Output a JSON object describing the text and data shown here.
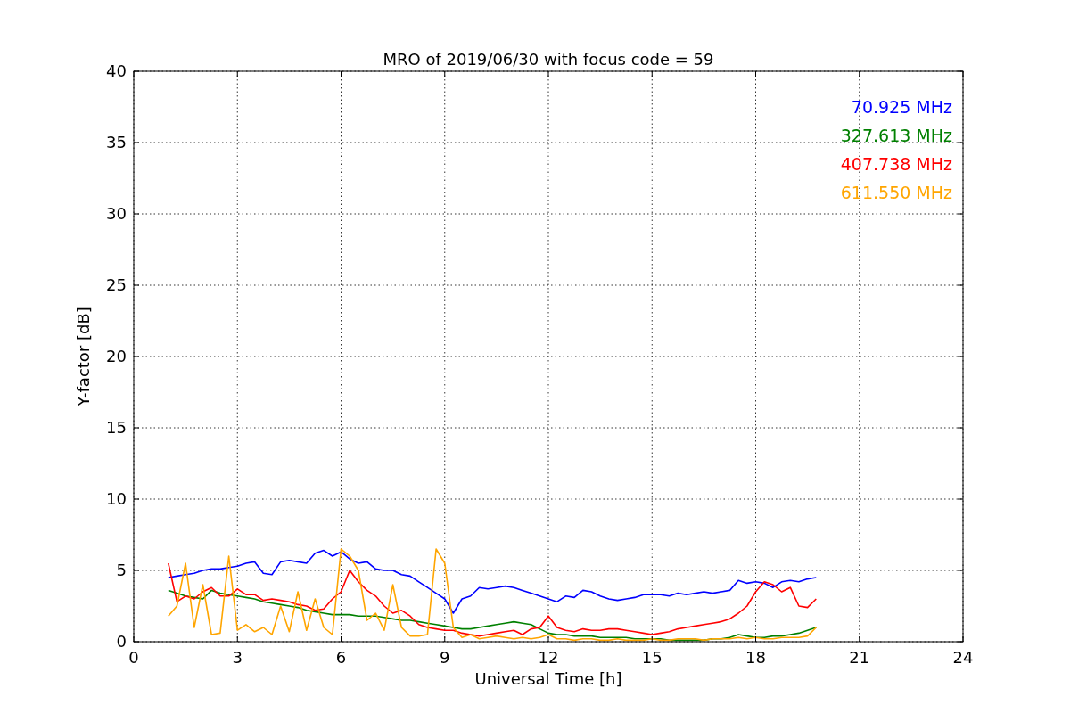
{
  "chart_data": {
    "type": "line",
    "title": "MRO of 2019/06/30 with focus code = 59",
    "xlabel": "Universal Time [h]",
    "ylabel": "Y-factor [dB]",
    "x": [
      1,
      1.25,
      1.5,
      1.75,
      2,
      2.25,
      2.5,
      2.75,
      3,
      3.25,
      3.5,
      3.75,
      4,
      4.25,
      4.5,
      4.75,
      5,
      5.25,
      5.5,
      5.75,
      6,
      6.25,
      6.5,
      6.75,
      7,
      7.25,
      7.5,
      7.75,
      8,
      8.25,
      8.5,
      8.75,
      9,
      9.25,
      9.5,
      9.75,
      10,
      10.25,
      10.5,
      10.75,
      11,
      11.25,
      11.5,
      11.75,
      12,
      12.25,
      12.5,
      12.75,
      13,
      13.25,
      13.5,
      13.75,
      14,
      14.25,
      14.5,
      14.75,
      15,
      15.25,
      15.5,
      15.75,
      16,
      16.25,
      16.5,
      16.75,
      17,
      17.25,
      17.5,
      17.75,
      18,
      18.25,
      18.5,
      18.75,
      19,
      19.25,
      19.5,
      19.75
    ],
    "series": [
      {
        "name": "70.925 MHz",
        "color": "#0000ff",
        "values": [
          4.5,
          4.6,
          4.7,
          4.8,
          5.0,
          5.1,
          5.1,
          5.2,
          5.3,
          5.5,
          5.6,
          4.8,
          4.7,
          5.6,
          5.7,
          5.6,
          5.5,
          6.2,
          6.4,
          6.0,
          6.3,
          5.8,
          5.5,
          5.6,
          5.1,
          5.0,
          5.0,
          4.7,
          4.6,
          4.2,
          3.8,
          3.4,
          3.0,
          2.0,
          3.0,
          3.2,
          3.8,
          3.7,
          3.8,
          3.9,
          3.8,
          3.6,
          3.4,
          3.2,
          3.0,
          2.8,
          3.2,
          3.1,
          3.6,
          3.5,
          3.2,
          3.0,
          2.9,
          3.0,
          3.1,
          3.3,
          3.3,
          3.3,
          3.2,
          3.4,
          3.3,
          3.4,
          3.5,
          3.4,
          3.5,
          3.6,
          4.3,
          4.1,
          4.2,
          4.1,
          3.8,
          4.2,
          4.3,
          4.2,
          4.4,
          4.5
        ]
      },
      {
        "name": "327.613 MHz",
        "color": "#008000",
        "values": [
          3.6,
          3.4,
          3.2,
          3.1,
          3.0,
          3.6,
          3.4,
          3.3,
          3.2,
          3.1,
          3.0,
          2.8,
          2.7,
          2.6,
          2.5,
          2.4,
          2.2,
          2.1,
          2.0,
          1.9,
          1.9,
          1.9,
          1.8,
          1.8,
          1.8,
          1.7,
          1.6,
          1.5,
          1.5,
          1.4,
          1.3,
          1.2,
          1.1,
          1.0,
          0.9,
          0.9,
          1.0,
          1.1,
          1.2,
          1.3,
          1.4,
          1.3,
          1.2,
          0.9,
          0.6,
          0.5,
          0.5,
          0.4,
          0.4,
          0.4,
          0.3,
          0.3,
          0.3,
          0.3,
          0.2,
          0.2,
          0.2,
          0.2,
          0.1,
          0.1,
          0.1,
          0.1,
          0.1,
          0.2,
          0.2,
          0.3,
          0.5,
          0.4,
          0.3,
          0.3,
          0.4,
          0.4,
          0.5,
          0.6,
          0.8,
          1.0
        ]
      },
      {
        "name": "407.738 MHz",
        "color": "#ff0000",
        "values": [
          5.5,
          2.8,
          3.2,
          3.0,
          3.5,
          3.8,
          3.2,
          3.2,
          3.7,
          3.3,
          3.3,
          2.9,
          3.0,
          2.9,
          2.8,
          2.6,
          2.5,
          2.2,
          2.3,
          3.0,
          3.5,
          5.0,
          4.2,
          3.6,
          3.2,
          2.5,
          2.0,
          2.2,
          1.8,
          1.2,
          1.0,
          0.9,
          0.8,
          0.8,
          0.6,
          0.5,
          0.4,
          0.5,
          0.6,
          0.7,
          0.8,
          0.5,
          0.9,
          1.0,
          1.8,
          1.0,
          0.8,
          0.7,
          0.9,
          0.8,
          0.8,
          0.9,
          0.9,
          0.8,
          0.7,
          0.6,
          0.5,
          0.6,
          0.7,
          0.9,
          1.0,
          1.1,
          1.2,
          1.3,
          1.4,
          1.6,
          2.0,
          2.5,
          3.5,
          4.2,
          4.0,
          3.5,
          3.8,
          2.5,
          2.4,
          3.0
        ]
      },
      {
        "name": "611.550 MHz",
        "color": "#ffa500",
        "values": [
          1.8,
          2.5,
          5.5,
          1.0,
          4.0,
          0.5,
          0.6,
          6.0,
          0.8,
          1.2,
          0.7,
          1.0,
          0.5,
          2.5,
          0.7,
          3.5,
          0.8,
          3.0,
          1.0,
          0.5,
          6.5,
          6.0,
          5.0,
          1.5,
          2.0,
          0.8,
          4.0,
          1.0,
          0.4,
          0.4,
          0.5,
          6.5,
          5.5,
          1.0,
          0.3,
          0.5,
          0.2,
          0.3,
          0.4,
          0.3,
          0.2,
          0.3,
          0.2,
          0.3,
          0.5,
          0.2,
          0.2,
          0.1,
          0.2,
          0.2,
          0.1,
          0.1,
          0.2,
          0.1,
          0.1,
          0.1,
          0.2,
          0.1,
          0.1,
          0.2,
          0.2,
          0.2,
          0.1,
          0.2,
          0.2,
          0.2,
          0.3,
          0.2,
          0.3,
          0.2,
          0.2,
          0.3,
          0.3,
          0.3,
          0.4,
          1.0
        ]
      }
    ],
    "grid": true,
    "xlim": [
      0,
      24
    ],
    "ylim": [
      0,
      40
    ],
    "xticks": [
      0,
      3,
      6,
      9,
      12,
      15,
      18,
      21,
      24
    ],
    "yticks": [
      0,
      5,
      10,
      15,
      20,
      25,
      30,
      35,
      40
    ]
  }
}
